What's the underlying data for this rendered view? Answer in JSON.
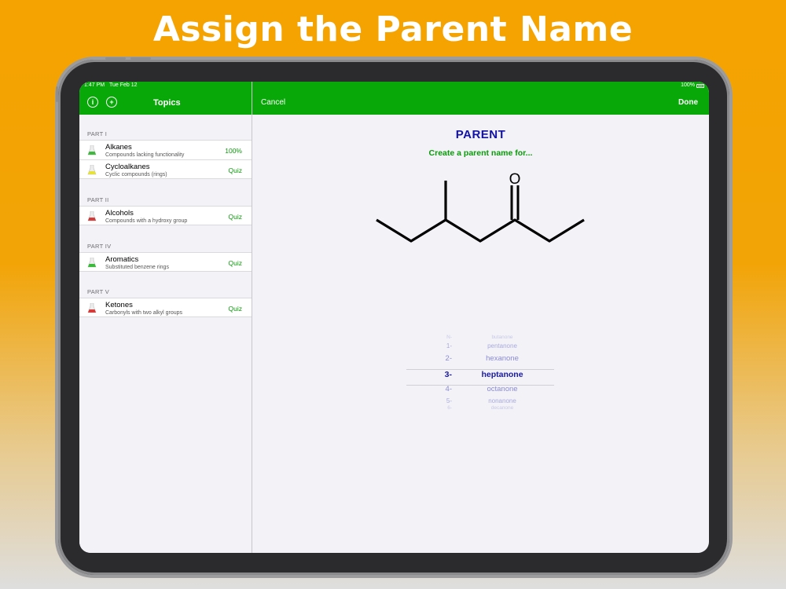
{
  "promo": {
    "title": "Assign the Parent Name"
  },
  "status_bar": {
    "time": "1:47 PM",
    "date": "Tue Feb 12",
    "battery": "100%"
  },
  "sidebar": {
    "title": "Topics",
    "sections": [
      {
        "header": "PART I",
        "items": [
          {
            "title": "Alkanes",
            "subtitle": "Compounds lacking functionality",
            "status": "100%",
            "flask_color": "#3cba3c"
          },
          {
            "title": "Cycloalkanes",
            "subtitle": "Cyclic compounds (rings)",
            "status": "Quiz",
            "flask_color": "#e6e23a"
          }
        ]
      },
      {
        "header": "PART II",
        "items": [
          {
            "title": "Alcohols",
            "subtitle": "Compounds with a hydroxy group",
            "status": "Quiz",
            "flask_color": "#d83a3a"
          }
        ]
      },
      {
        "header": "PART IV",
        "items": [
          {
            "title": "Aromatics",
            "subtitle": "Substituted benzene rings",
            "status": "Quiz",
            "flask_color": "#3cba3c"
          }
        ]
      },
      {
        "header": "PART V",
        "items": [
          {
            "title": "Ketones",
            "subtitle": "Carbonyls with two alkyl groups",
            "status": "Quiz",
            "flask_color": "#d83a3a"
          }
        ]
      }
    ]
  },
  "detail": {
    "cancel_label": "Cancel",
    "done_label": "Done",
    "title": "PARENT",
    "prompt": "Create a parent name for...",
    "molecule_atom_label": "O",
    "picker": {
      "selected_index": 3,
      "rows": [
        {
          "num": "N-",
          "name": "butanone"
        },
        {
          "num": "1-",
          "name": "pentanone"
        },
        {
          "num": "2-",
          "name": "hexanone"
        },
        {
          "num": "3-",
          "name": "heptanone"
        },
        {
          "num": "4-",
          "name": "octanone"
        },
        {
          "num": "5-",
          "name": "nonanone"
        },
        {
          "num": "6-",
          "name": "decanone"
        }
      ]
    }
  },
  "colors": {
    "nav_green": "#08a808",
    "accent_green": "#0a9a0a",
    "title_blue": "#1212a8",
    "picker_selected": "#1a1aa0",
    "picker_faded": "#7a7ad0"
  }
}
